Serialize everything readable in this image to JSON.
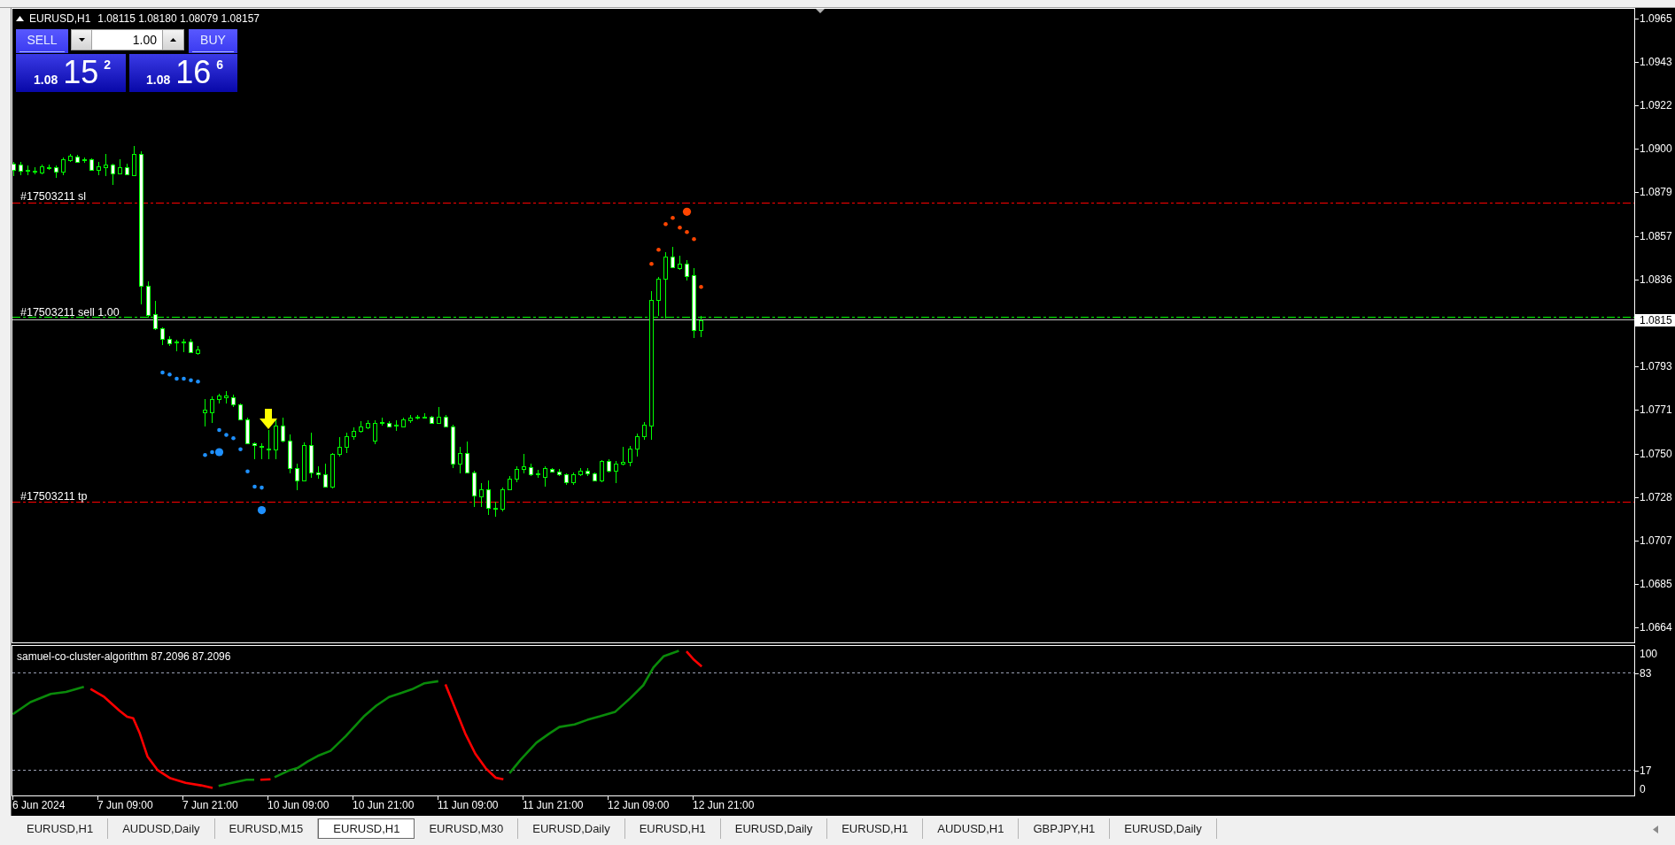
{
  "header": {
    "symbol": "EURUSD,H1",
    "quotes": "1.08115 1.08180 1.08079 1.08157"
  },
  "trade_panel": {
    "sell": "SELL",
    "buy": "BUY",
    "lot": "1.00",
    "sell_quote": {
      "big_figure": "1.08",
      "pips": "15",
      "point": "2"
    },
    "buy_quote": {
      "big_figure": "1.08",
      "pips": "16",
      "point": "6"
    }
  },
  "trade_lines": [
    {
      "kind": "sl",
      "label": "#17503211 sl"
    },
    {
      "kind": "entry",
      "label": "#17503211 sell 1.00"
    },
    {
      "kind": "tp",
      "label": "#17503211 tp"
    }
  ],
  "price_axis": [
    {
      "label": "1.0965",
      "kind": "tick"
    },
    {
      "label": "1.0943",
      "kind": "tick"
    },
    {
      "label": "1.0922",
      "kind": "tick"
    },
    {
      "label": "1.0900",
      "kind": "tick"
    },
    {
      "label": "1.0879",
      "kind": "tick"
    },
    {
      "label": "1.0857",
      "kind": "tick"
    },
    {
      "label": "1.0836",
      "kind": "tick"
    },
    {
      "label": "1.0815",
      "kind": "bid"
    },
    {
      "label": "1.0793",
      "kind": "tick"
    },
    {
      "label": "1.0771",
      "kind": "tick"
    },
    {
      "label": "1.0750",
      "kind": "tick"
    },
    {
      "label": "1.0728",
      "kind": "tick"
    },
    {
      "label": "1.0707",
      "kind": "tick"
    },
    {
      "label": "1.0685",
      "kind": "tick"
    },
    {
      "label": "1.0664",
      "kind": "tick"
    }
  ],
  "indicator": {
    "title": "samuel-co-cluster-algorithm 87.2096 87.2096",
    "levels": [
      {
        "label": "100",
        "kind": "bound"
      },
      {
        "label": "83",
        "kind": "level"
      },
      {
        "label": "17",
        "kind": "level"
      },
      {
        "label": "0",
        "kind": "bound"
      }
    ]
  },
  "time_axis": [
    "6 Jun 2024",
    "7 Jun 09:00",
    "7 Jun 21:00",
    "10 Jun 09:00",
    "10 Jun 21:00",
    "11 Jun 09:00",
    "11 Jun 21:00",
    "12 Jun 09:00",
    "12 Jun 21:00"
  ],
  "tabs": [
    {
      "label": "EURUSD,H1",
      "selected": false
    },
    {
      "label": "AUDUSD,Daily",
      "selected": false
    },
    {
      "label": "EURUSD,M15",
      "selected": false
    },
    {
      "label": "EURUSD,H1",
      "selected": true
    },
    {
      "label": "EURUSD,M30",
      "selected": false
    },
    {
      "label": "EURUSD,Daily",
      "selected": false
    },
    {
      "label": "EURUSD,H1",
      "selected": false
    },
    {
      "label": "EURUSD,Daily",
      "selected": false
    },
    {
      "label": "EURUSD,H1",
      "selected": false
    },
    {
      "label": "AUDUSD,H1",
      "selected": false
    },
    {
      "label": "GBPJPY,H1",
      "selected": false
    },
    {
      "label": "EURUSD,Daily",
      "selected": false
    }
  ]
}
